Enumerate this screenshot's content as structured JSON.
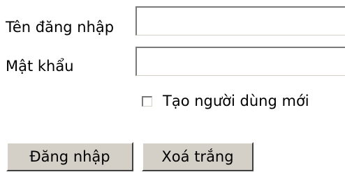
{
  "form": {
    "username_label": "Tên đăng nhập",
    "username_value": "",
    "password_label": "Mật khẩu",
    "password_value": "",
    "new_user_checkbox_label": "Tạo người dùng mới",
    "new_user_checked": false,
    "login_button_label": "Đăng nhập",
    "clear_button_label": "Xoá trắng"
  },
  "colors": {
    "background": "#ffffff",
    "button_face": "#d4d0c8",
    "border_dark": "#7a7a7a",
    "text": "#000000"
  }
}
